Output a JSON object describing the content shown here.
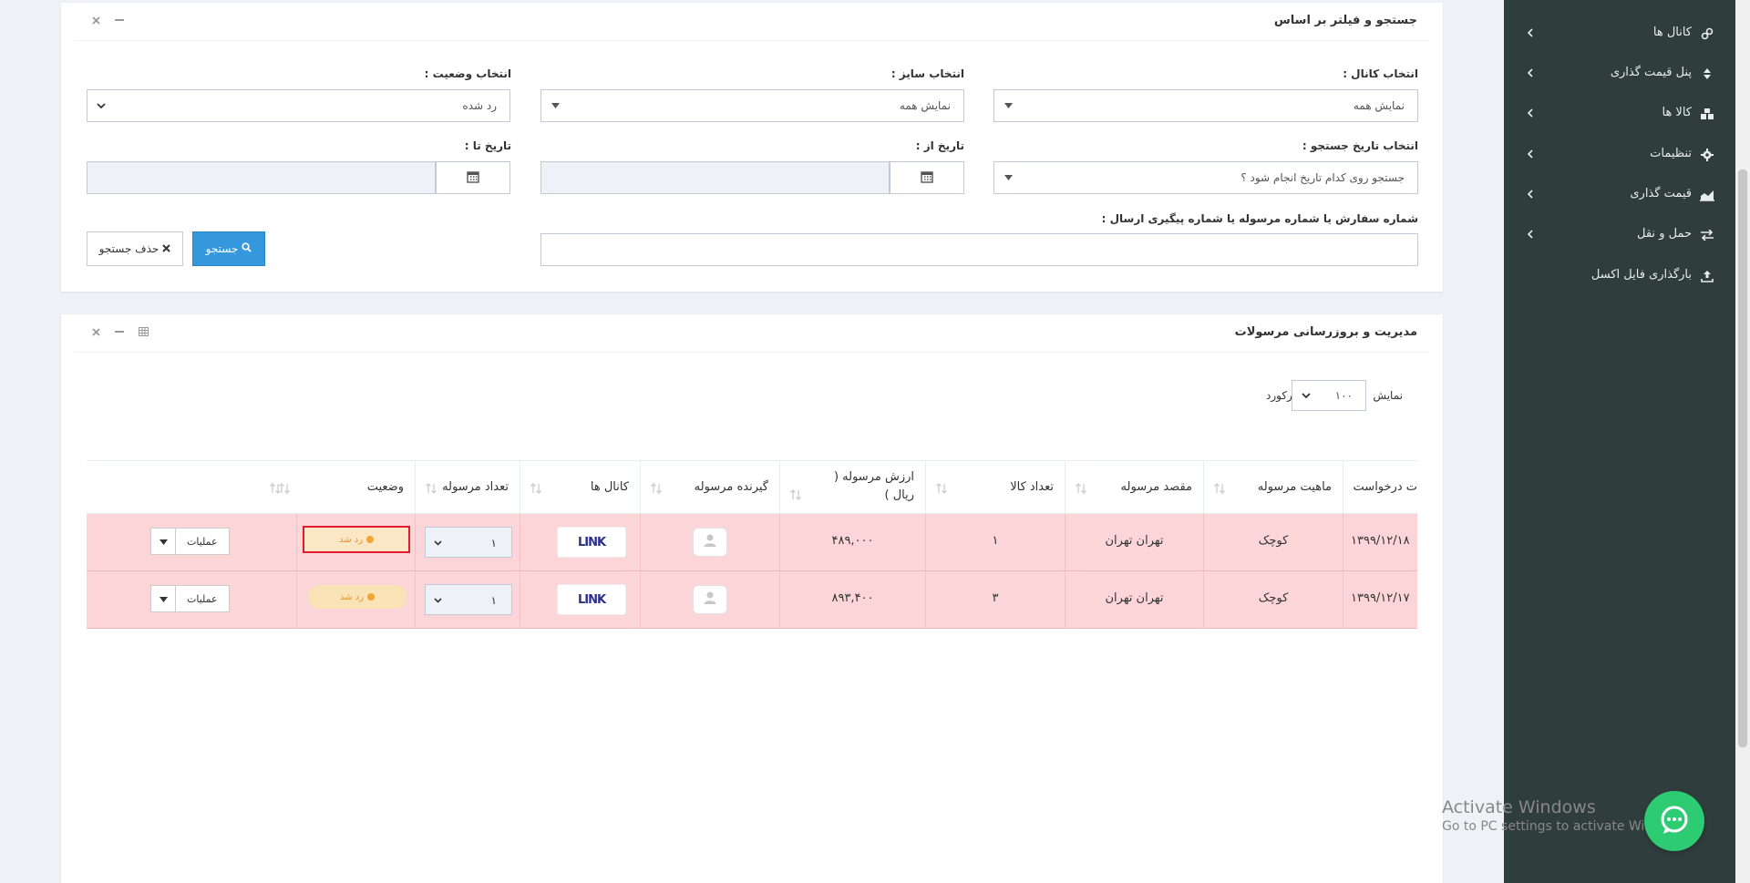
{
  "sidebar": {
    "items": [
      {
        "label": "کانال ها",
        "icon": "link-icon"
      },
      {
        "label": "پنل قیمت گذاری",
        "icon": "sort-icon"
      },
      {
        "label": "کالا ها",
        "icon": "cubes-icon"
      },
      {
        "label": "تنظیمات",
        "icon": "gear-icon"
      },
      {
        "label": "قیمت گذاری",
        "icon": "area-chart-icon"
      },
      {
        "label": "حمل و نقل",
        "icon": "exchange-icon"
      },
      {
        "label": "بارگذاری فایل اکسل",
        "icon": "upload-icon"
      }
    ]
  },
  "filter": {
    "title": "جستجو و فیلتر بر اساس",
    "channel_label": "انتخاب کانال :",
    "channel_value": "نمایش همه",
    "size_label": "انتخاب سایز :",
    "size_value": "نمایش همه",
    "status_label": "انتخاب وضعیت :",
    "status_value": "رد شده",
    "date_type_label": "انتخاب تاریخ جستجو :",
    "date_type_value": "جستجو روی کدام تاریخ انجام شود ؟",
    "date_from_label": "تاریخ از :",
    "date_to_label": "تاریخ تا :",
    "order_label": "شماره سفارش یا شماره مرسوله یا شماره پیگیری ارسال :",
    "search_button": "جستجو",
    "clear_button": "حذف جستجو"
  },
  "shipments": {
    "title": "مدیریت و بروزرسانی مرسولات",
    "show_label": "نمایش",
    "records_label": "رکورد",
    "page_size": "۱۰۰",
    "columns": {
      "date": "ت درخواست",
      "nature": "ماهیت مرسوله",
      "destination": "مقصد مرسوله",
      "item_count": "تعداد کالا",
      "value": "ارزش مرسوله ( ریال )",
      "receiver": "گیرنده مرسوله",
      "channels": "کانال ها",
      "package_count": "تعداد مرسوله",
      "status": "وضعیت"
    },
    "rows": [
      {
        "date": "۱۳۹۹/۱۲/۱۸",
        "nature": "کوچک",
        "destination": "تهران تهران",
        "item_count": "۱",
        "value": "۴۸۹,۰۰۰",
        "channel_logo": "LINK",
        "package_count": "۱",
        "status": "رد شد",
        "ops": "عملیات"
      },
      {
        "date": "۱۳۹۹/۱۲/۱۷",
        "nature": "کوچک",
        "destination": "تهران تهران",
        "item_count": "۳",
        "value": "۸۹۳,۴۰۰",
        "channel_logo": "LINK",
        "package_count": "۱",
        "status": "رد شد",
        "ops": "عملیات"
      }
    ]
  },
  "watermark": {
    "line1": "Activate Windows",
    "line2": "Go to PC settings to activate Windows."
  },
  "colors": {
    "accent": "#3598dc",
    "row_rejected": "#fbd5d7",
    "badge": "#f9e3b7",
    "sidebar": "#2f3d3c",
    "chat": "#2dcb72"
  }
}
